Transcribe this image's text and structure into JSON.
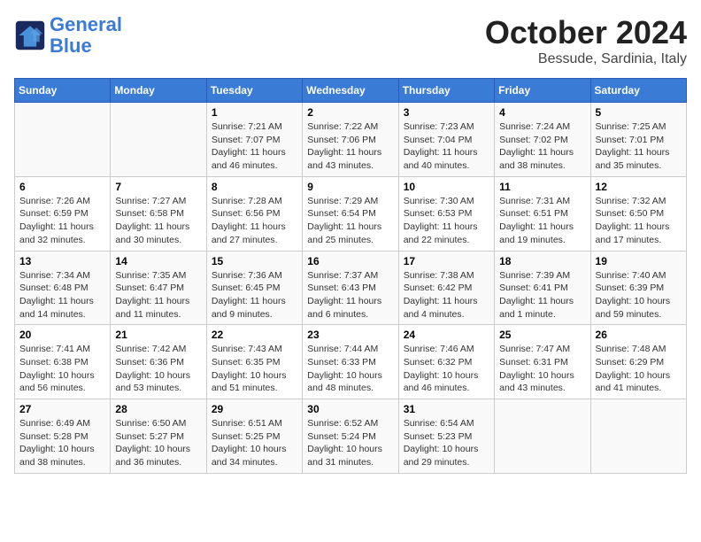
{
  "header": {
    "logo_line1": "General",
    "logo_line2": "Blue",
    "month": "October 2024",
    "location": "Bessude, Sardinia, Italy"
  },
  "days_of_week": [
    "Sunday",
    "Monday",
    "Tuesday",
    "Wednesday",
    "Thursday",
    "Friday",
    "Saturday"
  ],
  "weeks": [
    [
      {
        "day": "",
        "info": ""
      },
      {
        "day": "",
        "info": ""
      },
      {
        "day": "1",
        "info": "Sunrise: 7:21 AM\nSunset: 7:07 PM\nDaylight: 11 hours and 46 minutes."
      },
      {
        "day": "2",
        "info": "Sunrise: 7:22 AM\nSunset: 7:06 PM\nDaylight: 11 hours and 43 minutes."
      },
      {
        "day": "3",
        "info": "Sunrise: 7:23 AM\nSunset: 7:04 PM\nDaylight: 11 hours and 40 minutes."
      },
      {
        "day": "4",
        "info": "Sunrise: 7:24 AM\nSunset: 7:02 PM\nDaylight: 11 hours and 38 minutes."
      },
      {
        "day": "5",
        "info": "Sunrise: 7:25 AM\nSunset: 7:01 PM\nDaylight: 11 hours and 35 minutes."
      }
    ],
    [
      {
        "day": "6",
        "info": "Sunrise: 7:26 AM\nSunset: 6:59 PM\nDaylight: 11 hours and 32 minutes."
      },
      {
        "day": "7",
        "info": "Sunrise: 7:27 AM\nSunset: 6:58 PM\nDaylight: 11 hours and 30 minutes."
      },
      {
        "day": "8",
        "info": "Sunrise: 7:28 AM\nSunset: 6:56 PM\nDaylight: 11 hours and 27 minutes."
      },
      {
        "day": "9",
        "info": "Sunrise: 7:29 AM\nSunset: 6:54 PM\nDaylight: 11 hours and 25 minutes."
      },
      {
        "day": "10",
        "info": "Sunrise: 7:30 AM\nSunset: 6:53 PM\nDaylight: 11 hours and 22 minutes."
      },
      {
        "day": "11",
        "info": "Sunrise: 7:31 AM\nSunset: 6:51 PM\nDaylight: 11 hours and 19 minutes."
      },
      {
        "day": "12",
        "info": "Sunrise: 7:32 AM\nSunset: 6:50 PM\nDaylight: 11 hours and 17 minutes."
      }
    ],
    [
      {
        "day": "13",
        "info": "Sunrise: 7:34 AM\nSunset: 6:48 PM\nDaylight: 11 hours and 14 minutes."
      },
      {
        "day": "14",
        "info": "Sunrise: 7:35 AM\nSunset: 6:47 PM\nDaylight: 11 hours and 11 minutes."
      },
      {
        "day": "15",
        "info": "Sunrise: 7:36 AM\nSunset: 6:45 PM\nDaylight: 11 hours and 9 minutes."
      },
      {
        "day": "16",
        "info": "Sunrise: 7:37 AM\nSunset: 6:43 PM\nDaylight: 11 hours and 6 minutes."
      },
      {
        "day": "17",
        "info": "Sunrise: 7:38 AM\nSunset: 6:42 PM\nDaylight: 11 hours and 4 minutes."
      },
      {
        "day": "18",
        "info": "Sunrise: 7:39 AM\nSunset: 6:41 PM\nDaylight: 11 hours and 1 minute."
      },
      {
        "day": "19",
        "info": "Sunrise: 7:40 AM\nSunset: 6:39 PM\nDaylight: 10 hours and 59 minutes."
      }
    ],
    [
      {
        "day": "20",
        "info": "Sunrise: 7:41 AM\nSunset: 6:38 PM\nDaylight: 10 hours and 56 minutes."
      },
      {
        "day": "21",
        "info": "Sunrise: 7:42 AM\nSunset: 6:36 PM\nDaylight: 10 hours and 53 minutes."
      },
      {
        "day": "22",
        "info": "Sunrise: 7:43 AM\nSunset: 6:35 PM\nDaylight: 10 hours and 51 minutes."
      },
      {
        "day": "23",
        "info": "Sunrise: 7:44 AM\nSunset: 6:33 PM\nDaylight: 10 hours and 48 minutes."
      },
      {
        "day": "24",
        "info": "Sunrise: 7:46 AM\nSunset: 6:32 PM\nDaylight: 10 hours and 46 minutes."
      },
      {
        "day": "25",
        "info": "Sunrise: 7:47 AM\nSunset: 6:31 PM\nDaylight: 10 hours and 43 minutes."
      },
      {
        "day": "26",
        "info": "Sunrise: 7:48 AM\nSunset: 6:29 PM\nDaylight: 10 hours and 41 minutes."
      }
    ],
    [
      {
        "day": "27",
        "info": "Sunrise: 6:49 AM\nSunset: 5:28 PM\nDaylight: 10 hours and 38 minutes."
      },
      {
        "day": "28",
        "info": "Sunrise: 6:50 AM\nSunset: 5:27 PM\nDaylight: 10 hours and 36 minutes."
      },
      {
        "day": "29",
        "info": "Sunrise: 6:51 AM\nSunset: 5:25 PM\nDaylight: 10 hours and 34 minutes."
      },
      {
        "day": "30",
        "info": "Sunrise: 6:52 AM\nSunset: 5:24 PM\nDaylight: 10 hours and 31 minutes."
      },
      {
        "day": "31",
        "info": "Sunrise: 6:54 AM\nSunset: 5:23 PM\nDaylight: 10 hours and 29 minutes."
      },
      {
        "day": "",
        "info": ""
      },
      {
        "day": "",
        "info": ""
      }
    ]
  ]
}
